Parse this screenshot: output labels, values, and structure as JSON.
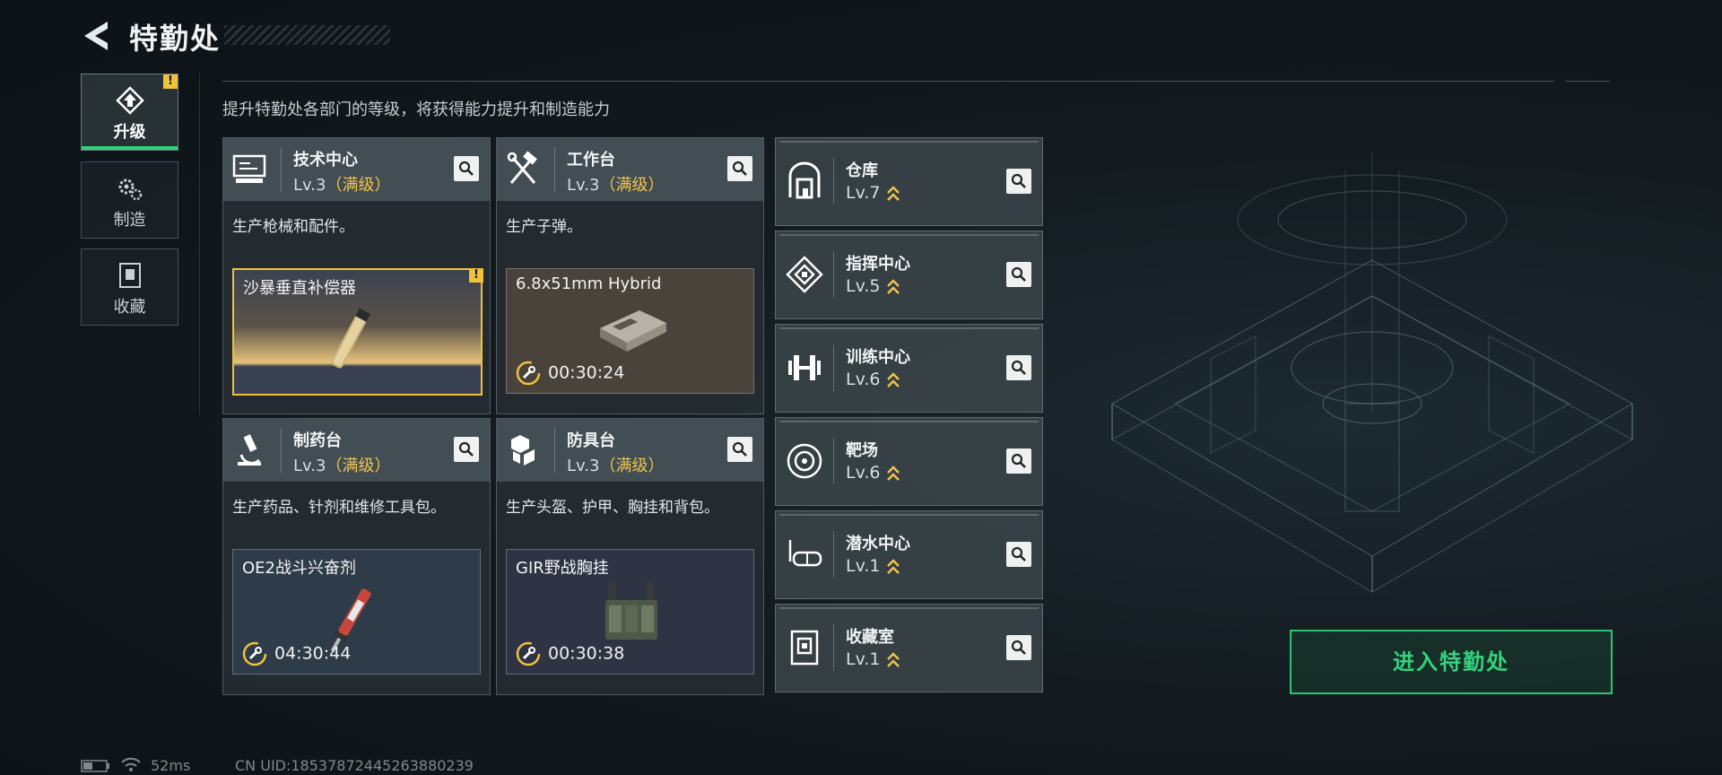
{
  "header": {
    "title": "特勤处"
  },
  "sidebar": {
    "tabs": [
      {
        "label": "升级",
        "badge": "!"
      },
      {
        "label": "制造"
      },
      {
        "label": "收藏"
      }
    ]
  },
  "intro": "提升特勤处各部门的等级，将获得能力提升和制造能力",
  "departments": [
    {
      "name": "技术中心",
      "level": "Lv.3",
      "max": "（满级）",
      "desc": "生产枪械和配件。",
      "craft": {
        "item": "沙暴垂直补偿器",
        "badge": "!"
      }
    },
    {
      "name": "工作台",
      "level": "Lv.3",
      "max": "（满级）",
      "desc": "生产子弹。",
      "craft": {
        "item": "6.8x51mm Hybrid",
        "timer": "00:30:24"
      }
    },
    {
      "name": "制药台",
      "level": "Lv.3",
      "max": "（满级）",
      "desc": "生产药品、针剂和维修工具包。",
      "craft": {
        "item": "OE2战斗兴奋剂",
        "timer": "04:30:44"
      }
    },
    {
      "name": "防具台",
      "level": "Lv.3",
      "max": "（满级）",
      "desc": "生产头盔、护甲、胸挂和背包。",
      "craft": {
        "item": "GIR野战胸挂",
        "timer": "00:30:38"
      }
    }
  ],
  "facilities": [
    {
      "name": "仓库",
      "level": "Lv.7",
      "icon": "warehouse-icon"
    },
    {
      "name": "指挥中心",
      "level": "Lv.5",
      "icon": "command-center-icon"
    },
    {
      "name": "训练中心",
      "level": "Lv.6",
      "icon": "dumbbell-icon"
    },
    {
      "name": "靶场",
      "level": "Lv.6",
      "icon": "target-icon"
    },
    {
      "name": "潜水中心",
      "level": "Lv.1",
      "icon": "diving-mask-icon"
    },
    {
      "name": "收藏室",
      "level": "Lv.1",
      "icon": "collection-icon"
    }
  ],
  "enter_button": "进入特勤处",
  "status": {
    "ping": "52ms",
    "uid": "CN UID:18537872445263880239"
  },
  "colors": {
    "accent_green": "#2ed47a",
    "max_level_gold": "#f1c44a",
    "warning": "#f0c23b"
  }
}
